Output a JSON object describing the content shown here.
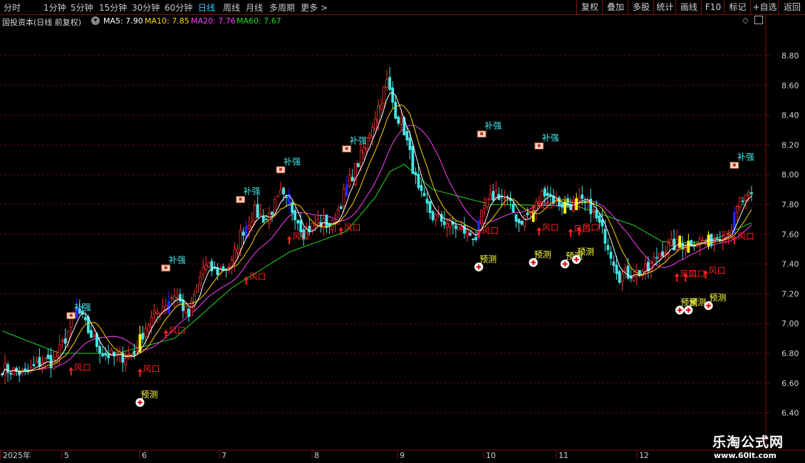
{
  "toolbar": {
    "tabs": [
      "分时",
      "1分钟",
      "5分钟",
      "15分钟",
      "30分钟",
      "60分钟",
      "日线",
      "周线",
      "月线",
      "多周期",
      "更多"
    ],
    "active_tab": "日线",
    "more_arrow": ">",
    "right_buttons": [
      "复权",
      "叠加",
      "多股",
      "统计",
      "画线",
      "F10",
      "标记",
      "+自选",
      "返回"
    ]
  },
  "info": {
    "title": "国投资本(日线 前复权)",
    "ma5": "MA5: 7.90",
    "ma10": "MA10: 7.85",
    "ma20": "MA20: 7.76",
    "ma60": "MA60: 7.67"
  },
  "colors": {
    "ma5": "#ffffff",
    "ma10": "#ffd200",
    "ma20": "#ff40ff",
    "ma60": "#22dd22",
    "candle_up": "#ff3030",
    "candle_down": "#44e6e6",
    "grid": "#7a1010",
    "axis_text": "#d0d0d0",
    "signal_arrow": "#ff2020",
    "signal_buqiang": "#44e6e6",
    "signal_yuce": "#ffff44",
    "highlight_yellow": "#ffff00",
    "highlight_blue": "#2222ff"
  },
  "watermark": {
    "line1": "乐淘公式网",
    "line2": "www.60lt.com"
  },
  "chart_data": {
    "type": "candlestick",
    "yaxis_ticks": [
      "8.80",
      "8.60",
      "8.40",
      "8.20",
      "8.00",
      "7.80",
      "7.60",
      "7.40",
      "7.20",
      "7.00",
      "6.80",
      "6.60",
      "6.40"
    ],
    "ylim": [
      6.28,
      8.92
    ],
    "xaxis_labels": [
      "2025年",
      "5",
      "6",
      "7",
      "8",
      "9",
      "10",
      "11",
      "12"
    ],
    "series_names": [
      "MA5",
      "MA10",
      "MA20",
      "MA60"
    ],
    "close_anchors": [
      [
        0,
        6.7
      ],
      [
        8,
        6.66
      ],
      [
        14,
        6.75
      ],
      [
        18,
        6.74
      ],
      [
        22,
        6.9
      ],
      [
        26,
        7.1
      ],
      [
        30,
        6.95
      ],
      [
        35,
        6.8
      ],
      [
        40,
        6.77
      ],
      [
        46,
        6.8
      ],
      [
        50,
        6.98
      ],
      [
        55,
        7.1
      ],
      [
        60,
        7.2
      ],
      [
        65,
        7.05
      ],
      [
        70,
        7.38
      ],
      [
        75,
        7.35
      ],
      [
        80,
        7.4
      ],
      [
        83,
        7.6
      ],
      [
        88,
        7.75
      ],
      [
        92,
        7.7
      ],
      [
        97,
        7.86
      ],
      [
        102,
        7.74
      ],
      [
        105,
        7.61
      ],
      [
        110,
        7.68
      ],
      [
        115,
        7.66
      ],
      [
        120,
        7.92
      ],
      [
        125,
        8.12
      ],
      [
        130,
        8.4
      ],
      [
        134,
        8.62
      ],
      [
        137,
        8.42
      ],
      [
        140,
        8.3
      ],
      [
        145,
        7.88
      ],
      [
        150,
        7.72
      ],
      [
        155,
        7.68
      ],
      [
        160,
        7.63
      ],
      [
        165,
        7.58
      ],
      [
        168,
        7.78
      ],
      [
        172,
        7.88
      ],
      [
        176,
        7.82
      ],
      [
        180,
        7.68
      ],
      [
        185,
        7.76
      ],
      [
        189,
        7.9
      ],
      [
        193,
        7.81
      ],
      [
        197,
        7.8
      ],
      [
        201,
        7.81
      ],
      [
        205,
        7.78
      ],
      [
        210,
        7.58
      ],
      [
        215,
        7.32
      ],
      [
        220,
        7.34
      ],
      [
        225,
        7.36
      ],
      [
        229,
        7.48
      ],
      [
        233,
        7.52
      ],
      [
        238,
        7.54
      ],
      [
        242,
        7.56
      ],
      [
        246,
        7.55
      ],
      [
        250,
        7.6
      ],
      [
        254,
        7.65
      ],
      [
        257,
        7.82
      ],
      [
        260,
        7.84
      ]
    ],
    "ma60_anchors": [
      [
        0,
        6.95
      ],
      [
        20,
        6.8
      ],
      [
        40,
        6.8
      ],
      [
        60,
        6.9
      ],
      [
        80,
        7.24
      ],
      [
        100,
        7.48
      ],
      [
        120,
        7.62
      ],
      [
        130,
        7.85
      ],
      [
        135,
        8.02
      ],
      [
        140,
        8.07
      ],
      [
        150,
        7.9
      ],
      [
        170,
        7.8
      ],
      [
        200,
        7.79
      ],
      [
        220,
        7.66
      ],
      [
        230,
        7.55
      ],
      [
        240,
        7.54
      ],
      [
        250,
        7.58
      ],
      [
        260,
        7.67
      ]
    ],
    "signals": {
      "buqiang": [
        [
          24,
          7.06
        ],
        [
          57,
          7.38
        ],
        [
          83,
          7.84
        ],
        [
          97,
          8.04
        ],
        [
          120,
          8.18
        ],
        [
          167,
          8.28
        ],
        [
          187,
          8.2
        ],
        [
          255,
          8.07
        ]
      ],
      "fengkou": [
        [
          24,
          6.68
        ],
        [
          48,
          6.67
        ],
        [
          57,
          6.93
        ],
        [
          85,
          7.29
        ],
        [
          100,
          7.56
        ],
        [
          118,
          7.62
        ],
        [
          166,
          7.6
        ],
        [
          185,
          7.77
        ],
        [
          187,
          7.62
        ],
        [
          198,
          7.61
        ],
        [
          201,
          7.62
        ],
        [
          235,
          7.31
        ],
        [
          238,
          7.31
        ],
        [
          245,
          7.33
        ],
        [
          255,
          7.56
        ]
      ],
      "yuce": [
        [
          48,
          6.47
        ],
        [
          166,
          7.38
        ],
        [
          185,
          7.41
        ],
        [
          196,
          7.4
        ],
        [
          200,
          7.43
        ],
        [
          236,
          7.09
        ],
        [
          239,
          7.09
        ],
        [
          246,
          7.12
        ]
      ]
    },
    "yellow_days": [
      48,
      185,
      196,
      200,
      236,
      239,
      246
    ],
    "blue_days": [
      26,
      58,
      85,
      100,
      120,
      166,
      255
    ]
  }
}
